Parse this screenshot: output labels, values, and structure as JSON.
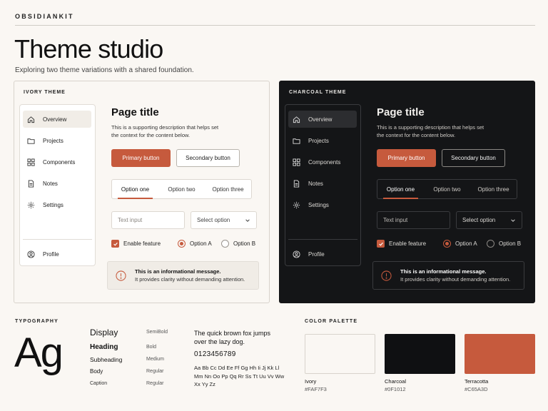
{
  "brand": "OBSIDIANKIT",
  "hero": {
    "title": "Theme studio",
    "subtitle": "Exploring two theme variations with a shared foundation."
  },
  "themes": [
    {
      "label": "IVORY THEME",
      "nav": [
        {
          "label": "Overview",
          "icon": "home-icon",
          "active": true
        },
        {
          "label": "Projects",
          "icon": "folder-icon"
        },
        {
          "label": "Components",
          "icon": "grid-icon"
        },
        {
          "label": "Notes",
          "icon": "document-icon"
        },
        {
          "label": "Settings",
          "icon": "gear-icon"
        }
      ],
      "profile": "Profile",
      "page_title": "Page title",
      "page_desc": "This is a supporting description that helps set the context for the content below.",
      "primary_button": "Primary button",
      "secondary_button": "Secondary button",
      "tabs": [
        "Option one",
        "Option two",
        "Option three"
      ],
      "active_tab": 0,
      "text_input_placeholder": "Text input",
      "select_value": "Select option",
      "checkbox_label": "Enable feature",
      "checkbox_checked": true,
      "radio_a": "Option A",
      "radio_b": "Option B",
      "radio_selected": "Option A",
      "alert_title": "This is an informational message.",
      "alert_body": "It provides clarity without demanding attention."
    },
    {
      "label": "CHARCOAL THEME",
      "nav": [
        {
          "label": "Overview",
          "icon": "home-icon",
          "active": true
        },
        {
          "label": "Projects",
          "icon": "folder-icon"
        },
        {
          "label": "Components",
          "icon": "grid-icon"
        },
        {
          "label": "Notes",
          "icon": "document-icon"
        },
        {
          "label": "Settings",
          "icon": "gear-icon"
        }
      ],
      "profile": "Profile",
      "page_title": "Page title",
      "page_desc": "This is a supporting description that helps set the context for the content below.",
      "primary_button": "Primary button",
      "secondary_button": "Secondary button",
      "tabs": [
        "Option one",
        "Option two",
        "Option three"
      ],
      "active_tab": 0,
      "text_input_placeholder": "Text input",
      "select_value": "Select option",
      "checkbox_label": "Enable feature",
      "checkbox_checked": true,
      "radio_a": "Option A",
      "radio_b": "Option B",
      "radio_selected": "Option A",
      "alert_title": "This is an informational message.",
      "alert_body": "It provides clarity without demanding attention."
    }
  ],
  "typography": {
    "label": "TYPOGRAPHY",
    "specimen": "Ag",
    "styles": [
      {
        "name": "Display",
        "weight": "SemiBold"
      },
      {
        "name": "Heading",
        "weight": "Bold"
      },
      {
        "name": "Subheading",
        "weight": "Medium"
      },
      {
        "name": "Body",
        "weight": "Regular"
      },
      {
        "name": "Caption",
        "weight": "Regular"
      }
    ],
    "pangram": "The quick brown fox jumps over the lazy dog.",
    "digits": "0123456789",
    "alphabet": "Aa Bb Cc Dd Ee Ff Gg Hh Ii Jj Kk Ll Mm Nn Oo Pp Qq Rr Ss Tt Uu Vv Ww Xx Yy Zz"
  },
  "palette": {
    "label": "COLOR PALETTE",
    "swatches": [
      {
        "name": "Ivory",
        "hex": "#FAF7F3"
      },
      {
        "name": "Charcoal",
        "hex": "#0F1012"
      },
      {
        "name": "Terracotta",
        "hex": "#C65A3D"
      }
    ]
  },
  "colors": {
    "accent": "#C65A3D",
    "ivory": "#FAF7F3",
    "charcoal": "#0F1012"
  }
}
